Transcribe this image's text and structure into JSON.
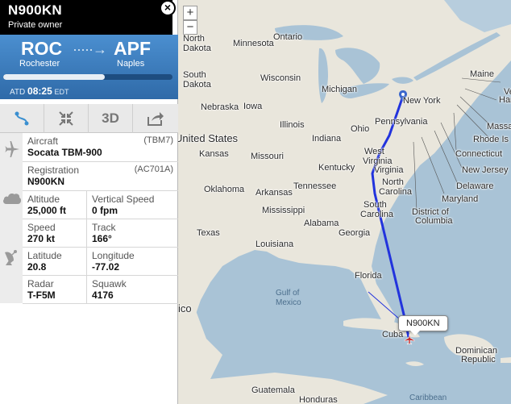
{
  "flight": {
    "registration": "N900KN",
    "owner": "Private owner",
    "origin_code": "ROC",
    "origin_city": "Rochester",
    "dest_code": "APF",
    "dest_city": "Naples",
    "progress": 0.6,
    "atd_label": "ATD",
    "atd_time": "08:25",
    "atd_tz": "EDT"
  },
  "toolbar": {
    "route_icon": "route-icon",
    "fit_icon": "fit-view-icon",
    "view3d_label": "3D",
    "share_icon": "share-icon"
  },
  "details": {
    "aircraft_label": "Aircraft",
    "aircraft_code": "(TBM7)",
    "aircraft_value": "Socata TBM-900",
    "registration_label": "Registration",
    "registration_code": "(AC701A)",
    "registration_value": "N900KN",
    "altitude_label": "Altitude",
    "altitude_value": "25,000 ft",
    "vspeed_label": "Vertical Speed",
    "vspeed_value": "0 fpm",
    "speed_label": "Speed",
    "speed_value": "270 kt",
    "track_label": "Track",
    "track_value": "166°",
    "lat_label": "Latitude",
    "lat_value": "20.8",
    "lon_label": "Longitude",
    "lon_value": "-77.02",
    "radar_label": "Radar",
    "radar_value": "T-F5M",
    "squawk_label": "Squawk",
    "squawk_value": "4176"
  },
  "map": {
    "zoom_in": "+",
    "zoom_out": "−",
    "callout": "N900KN",
    "colors": {
      "land": "#e9e6dc",
      "water": "#a9c3d6",
      "track": "#2233dd"
    },
    "labels": {
      "ontario": "Ontario",
      "north_dakota_1": "North",
      "north_dakota_2": "Dakota",
      "south_dakota_1": "South",
      "south_dakota_2": "Dakota",
      "minnesota": "Minnesota",
      "wisconsin": "Wisconsin",
      "michigan": "Michigan",
      "nebraska": "Nebraska",
      "iowa": "Iowa",
      "illinois": "Illinois",
      "indiana": "Indiana",
      "ohio": "Ohio",
      "united_states": "United States",
      "kansas": "Kansas",
      "missouri": "Missouri",
      "kentucky": "Kentucky",
      "west_virginia_1": "West",
      "west_virginia_2": "Virginia",
      "virginia": "Virginia",
      "oklahoma": "Oklahoma",
      "arkansas": "Arkansas",
      "tennessee": "Tennessee",
      "north_carolina_1": "North",
      "north_carolina_2": "Carolina",
      "south_carolina_1": "South",
      "south_carolina_2": "Carolina",
      "mississippi": "Mississippi",
      "alabama": "Alabama",
      "georgia": "Georgia",
      "texas": "Texas",
      "louisiana": "Louisiana",
      "florida": "Florida",
      "pennsylvania": "Pennsylvania",
      "new_york": "New York",
      "maine": "Maine",
      "ve": "Ve",
      "ham": "Ham",
      "massa": "Massa",
      "rhode": "Rhode Is",
      "connecticut": "Connecticut",
      "new_jersey": "New Jersey",
      "delaware": "Delaware",
      "maryland": "Maryland",
      "dc_1": "District of",
      "dc_2": "Columbia",
      "gulf_1": "Gulf of",
      "gulf_2": "Mexico",
      "cuba": "Cuba",
      "dominican_1": "Dominican",
      "dominican_2": "Republic",
      "mexico_partial": "ico",
      "guatemala": "Guatemala",
      "honduras": "Honduras",
      "caribbean": "Caribbean"
    }
  }
}
